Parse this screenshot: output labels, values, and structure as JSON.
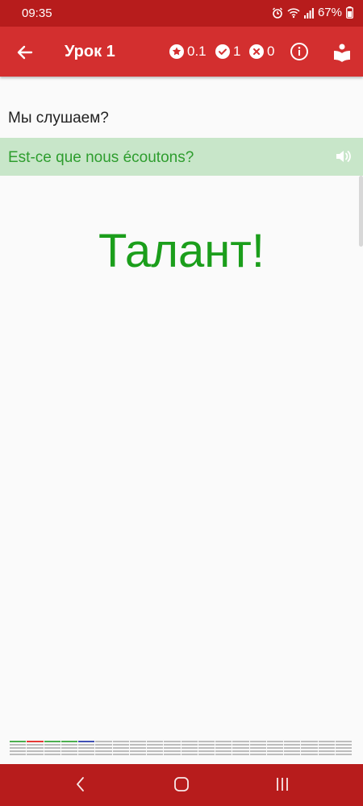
{
  "status": {
    "time": "09:35",
    "battery": "67%"
  },
  "header": {
    "title": "Урок 1",
    "stars": "0.1",
    "correct": "1",
    "wrong": "0"
  },
  "question": "Мы слушаем?",
  "answer": "Est-ce que nous écoutons?",
  "feedback": "Талант!",
  "progress": {
    "segments": [
      "correct",
      "wrong",
      "correct",
      "correct",
      "current",
      "pending",
      "pending",
      "pending",
      "pending",
      "pending",
      "pending",
      "pending",
      "pending",
      "pending",
      "pending",
      "pending",
      "pending",
      "pending",
      "pending",
      "pending"
    ],
    "colors": {
      "correct": "#4caf50",
      "wrong": "#e53935",
      "current": "#3f51b5",
      "pending": "#bdbdbd"
    }
  },
  "colors": {
    "primary": "#d32f2f",
    "primary_dark": "#b71c1c",
    "accent_green": "#2e9d2e",
    "answer_bg": "#c8e6c9"
  },
  "icons": {
    "back": "arrow-left-icon",
    "star": "star-icon",
    "check": "check-icon",
    "cross": "cross-icon",
    "info": "info-icon",
    "book": "book-icon",
    "speaker": "speaker-icon"
  }
}
